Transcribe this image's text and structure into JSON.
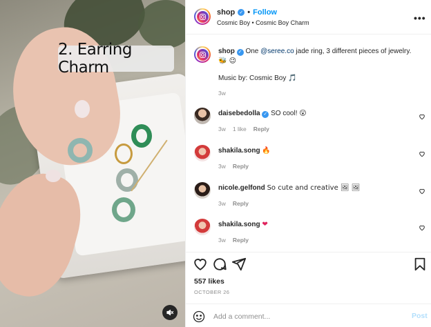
{
  "media": {
    "caption": "2. Earring Charm"
  },
  "header": {
    "username": "shop",
    "separator": "•",
    "follow_label": "Follow",
    "subtitle": "Cosmic Boy • Cosmic Boy Charm",
    "more_label": "•••"
  },
  "post": {
    "username": "shop",
    "text_before": "One ",
    "mention": "@seree.co",
    "text_after": " jade ring, 3 different pieces of jewelry.",
    "emoji": "🐝 😉",
    "music": "Music by: Cosmic Boy 🎵",
    "time": "3w"
  },
  "comments": [
    {
      "username": "daisebedolla",
      "verified": true,
      "text": "SO cool! 😮",
      "time": "3w",
      "likes": "1 like",
      "reply": "Reply"
    },
    {
      "username": "shakila.song",
      "verified": false,
      "text": "🔥",
      "time": "3w",
      "likes": "",
      "reply": "Reply"
    },
    {
      "username": "nicole.gelfond",
      "verified": false,
      "text": "So cute and creative 🖼 🖼",
      "time": "3w",
      "likes": "",
      "reply": "Reply"
    },
    {
      "username": "shakila.song",
      "verified": false,
      "text": "❤",
      "time": "3w",
      "likes": "",
      "reply": "Reply"
    }
  ],
  "engagement": {
    "likes": "557 likes",
    "date": "OCTOBER 26"
  },
  "add_comment": {
    "placeholder": "Add a comment...",
    "post_label": "Post"
  },
  "colors": {
    "accent": "#0095f6",
    "verified": "#3897f0",
    "muted": "#8e8e8e",
    "heart_red": "#e0245e"
  },
  "icons": [
    "heart-icon",
    "comment-icon",
    "share-icon",
    "bookmark-icon",
    "mute-icon",
    "emoji-icon",
    "more-icon"
  ]
}
